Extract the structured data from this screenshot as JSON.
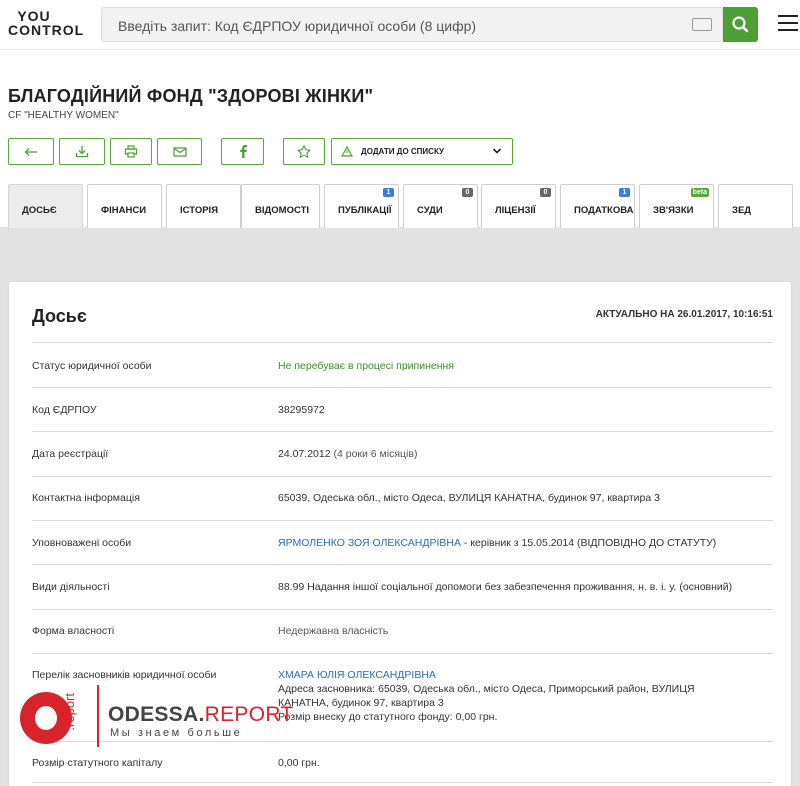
{
  "header": {
    "logo_line1": "YOU",
    "logo_line2": "CONTROL",
    "search_placeholder": "Введіть запит:  Код ЄДРПОУ юридичної особи (8 цифр)"
  },
  "company": {
    "name": "БЛАГОДІЙНИЙ ФОНД \"ЗДОРОВІ ЖІНКИ\"",
    "name_en": "CF \"HEALTHY WOMEN\""
  },
  "actions": {
    "add_to_list": "ДОДАТИ ДО СПИСКУ"
  },
  "tabs": [
    {
      "label": "ДОСЬЄ",
      "badge": ""
    },
    {
      "label": "ФІНАНСИ",
      "badge": ""
    },
    {
      "label": "ІСТОРІЯ",
      "badge": ""
    },
    {
      "label": "ВІДОМОСТІ",
      "badge": ""
    },
    {
      "label": "ПУБЛІКАЦІЇ",
      "badge": "1"
    },
    {
      "label": "СУДИ",
      "badge": "0"
    },
    {
      "label": "ЛІЦЕНЗІЇ",
      "badge": "0"
    },
    {
      "label": "ПОДАТКОВА",
      "badge": "1"
    },
    {
      "label": "ЗВ'ЯЗКИ",
      "badge": "beta"
    },
    {
      "label": "ЗЕД",
      "badge": ""
    }
  ],
  "dossier": {
    "title": "Досьє",
    "actual": "АКТУАЛЬНО НА 26.01.2017, 10:16:51",
    "rows": {
      "status_label": "Статус юридичної особи",
      "status_value": "Не перебуває в процесі припинення",
      "code_label": "Код ЄДРПОУ",
      "code_value": "38295972",
      "reg_label": "Дата реєстрації",
      "reg_date": "24.07.2012",
      "reg_duration": "(4 роки 6 місяців)",
      "contact_label": "Контактна інформація",
      "contact_value": "65039, Одеська обл., місто Одеса, ВУЛИЦЯ КАНАТНА, будинок 97, квартира 3",
      "persons_label": "Уповноважені особи",
      "persons_name": "ЯРМОЛЕНКО ЗОЯ ОЛЕКСАНДРІВНА",
      "persons_role": " - керівник з 15.05.2014 (ВІДПОВІДНО ДО СТАТУТУ)",
      "activity_label": "Види діяльності",
      "activity_value": "88.99 Надання іншої соціальної допомоги без забезпечення проживання, н. в. і. у. (основний)",
      "ownership_label": "Форма власності",
      "ownership_value": "Недержавна власність",
      "founders_label": "Перелік засновників юридичної особи",
      "founder_name": "ХМАРА ЮЛІЯ ОЛЕКСАНДРІВНА",
      "founder_addr1": "Адреса засновника: 65039, Одеська обл., місто Одеса, Приморський район, ВУЛИЦЯ",
      "founder_addr2": "КАНАТНА, будинок 97, квартира 3",
      "founder_share": "Розмір внеску до статутного фонду: 0,00 грн.",
      "capital_label": "Розмір статутного капіталу",
      "capital_value": "0,00 грн."
    }
  },
  "watermark": {
    "vertical": ".report",
    "brand_main": "ODESSA.",
    "brand_accent": "REPORT",
    "tagline": "Мы знаем больше"
  },
  "colors": {
    "accent_green": "#4d9e36",
    "link_blue": "#2b6cb0",
    "badge_blue": "#3b7dd8",
    "badge_dark": "#666666",
    "badge_green": "#5aa83a",
    "watermark_red": "#d8232a"
  },
  "icons": {
    "back": "arrow-left-icon",
    "download": "download-icon",
    "print": "printer-icon",
    "email": "envelope-icon",
    "facebook": "facebook-icon",
    "favorite": "star-icon",
    "list": "warning-triangle-icon"
  }
}
